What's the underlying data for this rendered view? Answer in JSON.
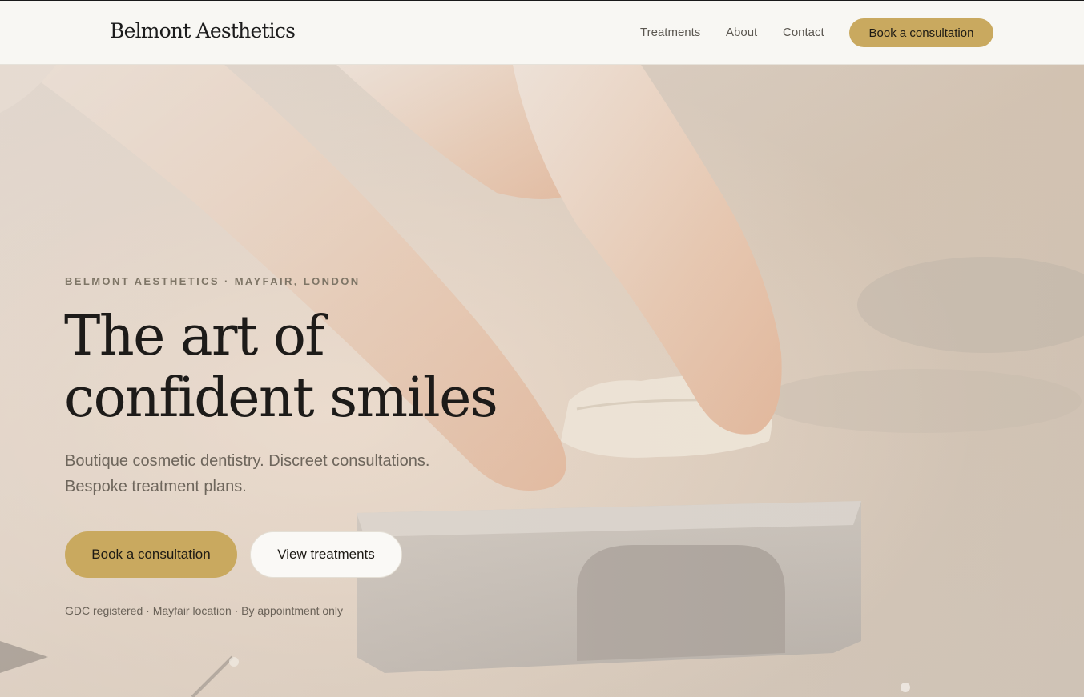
{
  "header": {
    "brand": "Belmont Aesthetics",
    "nav": [
      {
        "label": "Treatments"
      },
      {
        "label": "About"
      },
      {
        "label": "Contact"
      }
    ],
    "cta_label": "Book a consultation"
  },
  "hero": {
    "eyebrow": "BELMONT AESTHETICS · MAYFAIR, LONDON",
    "headline_line1": "The art of",
    "headline_line2": "confident smiles",
    "subtitle_line1": "Boutique cosmetic dentistry. Discreet consultations.",
    "subtitle_line2": "Bespoke treatment plans.",
    "primary_button": "Book a consultation",
    "secondary_button": "View treatments",
    "trust_line": "GDC registered · Mayfair location · By appointment only"
  },
  "colors": {
    "accent": "#c9a95f",
    "header_bg": "#f8f7f3",
    "headline": "#1d1b19"
  }
}
